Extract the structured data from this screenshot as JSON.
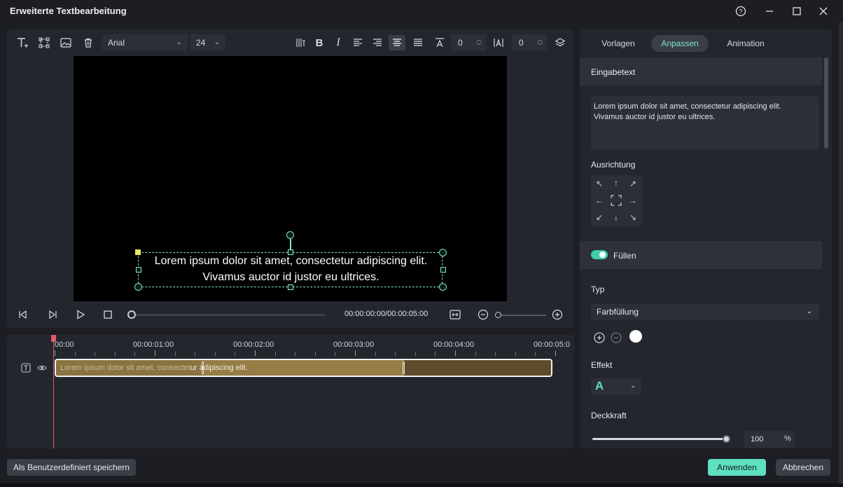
{
  "window": {
    "title": "Erweiterte Textbearbeitung",
    "help_icon": "?",
    "minimize_icon": "—",
    "maximize_icon": "☐",
    "close_icon": "✕"
  },
  "toolbar": {
    "font": "Arial",
    "size": "24",
    "bold": "B",
    "italic": "I",
    "char_spacing": "0",
    "line_spacing": "0"
  },
  "preview": {
    "line1": "Lorem ipsum dolor sit amet, consectetur adipiscing elit.",
    "line2": "Vivamus auctor id justor eu ultrices."
  },
  "playback": {
    "time": "00:00:00:00/00:00:05:00",
    "progress": 0,
    "zoom_level": 0
  },
  "timeline": {
    "ruler": [
      "00:00",
      "00:00:01:00",
      "00:00:02:00",
      "00:00:03:00",
      "00:00:04:00",
      "00:00:05:0"
    ],
    "clip_text_dim": "Lorem ipsum dolor sit amet, consectet",
    "clip_text_bright": "ur adipiscing elit."
  },
  "panel": {
    "tabs": [
      "Vorlagen",
      "Anpassen",
      "Animation"
    ],
    "active_tab": "Anpassen",
    "input_section": "Eingabetext",
    "input_text_line1": "Lorem ipsum dolor sit amet, consectetur adipiscing elit.",
    "input_text_line2": "Vivamus auctor id justor eu ultrices.",
    "alignment_label": "Ausrichtung",
    "fill_label": "Füllen",
    "fill_enabled": true,
    "type_label": "Typ",
    "type_value": "Farbfüllung",
    "fill_color": "#ffffff",
    "effect_label": "Effekt",
    "effect_glyph": "A",
    "opacity_label": "Deckkraft",
    "opacity_value": "100",
    "opacity_unit": "%"
  },
  "footer": {
    "save_custom": "Als Benutzerdefiniert speichern",
    "apply": "Anwenden",
    "cancel": "Abbrechen"
  },
  "colors": {
    "accent": "#5fe0c0",
    "playhead": "#e55a6a",
    "clip": "#967c45"
  }
}
